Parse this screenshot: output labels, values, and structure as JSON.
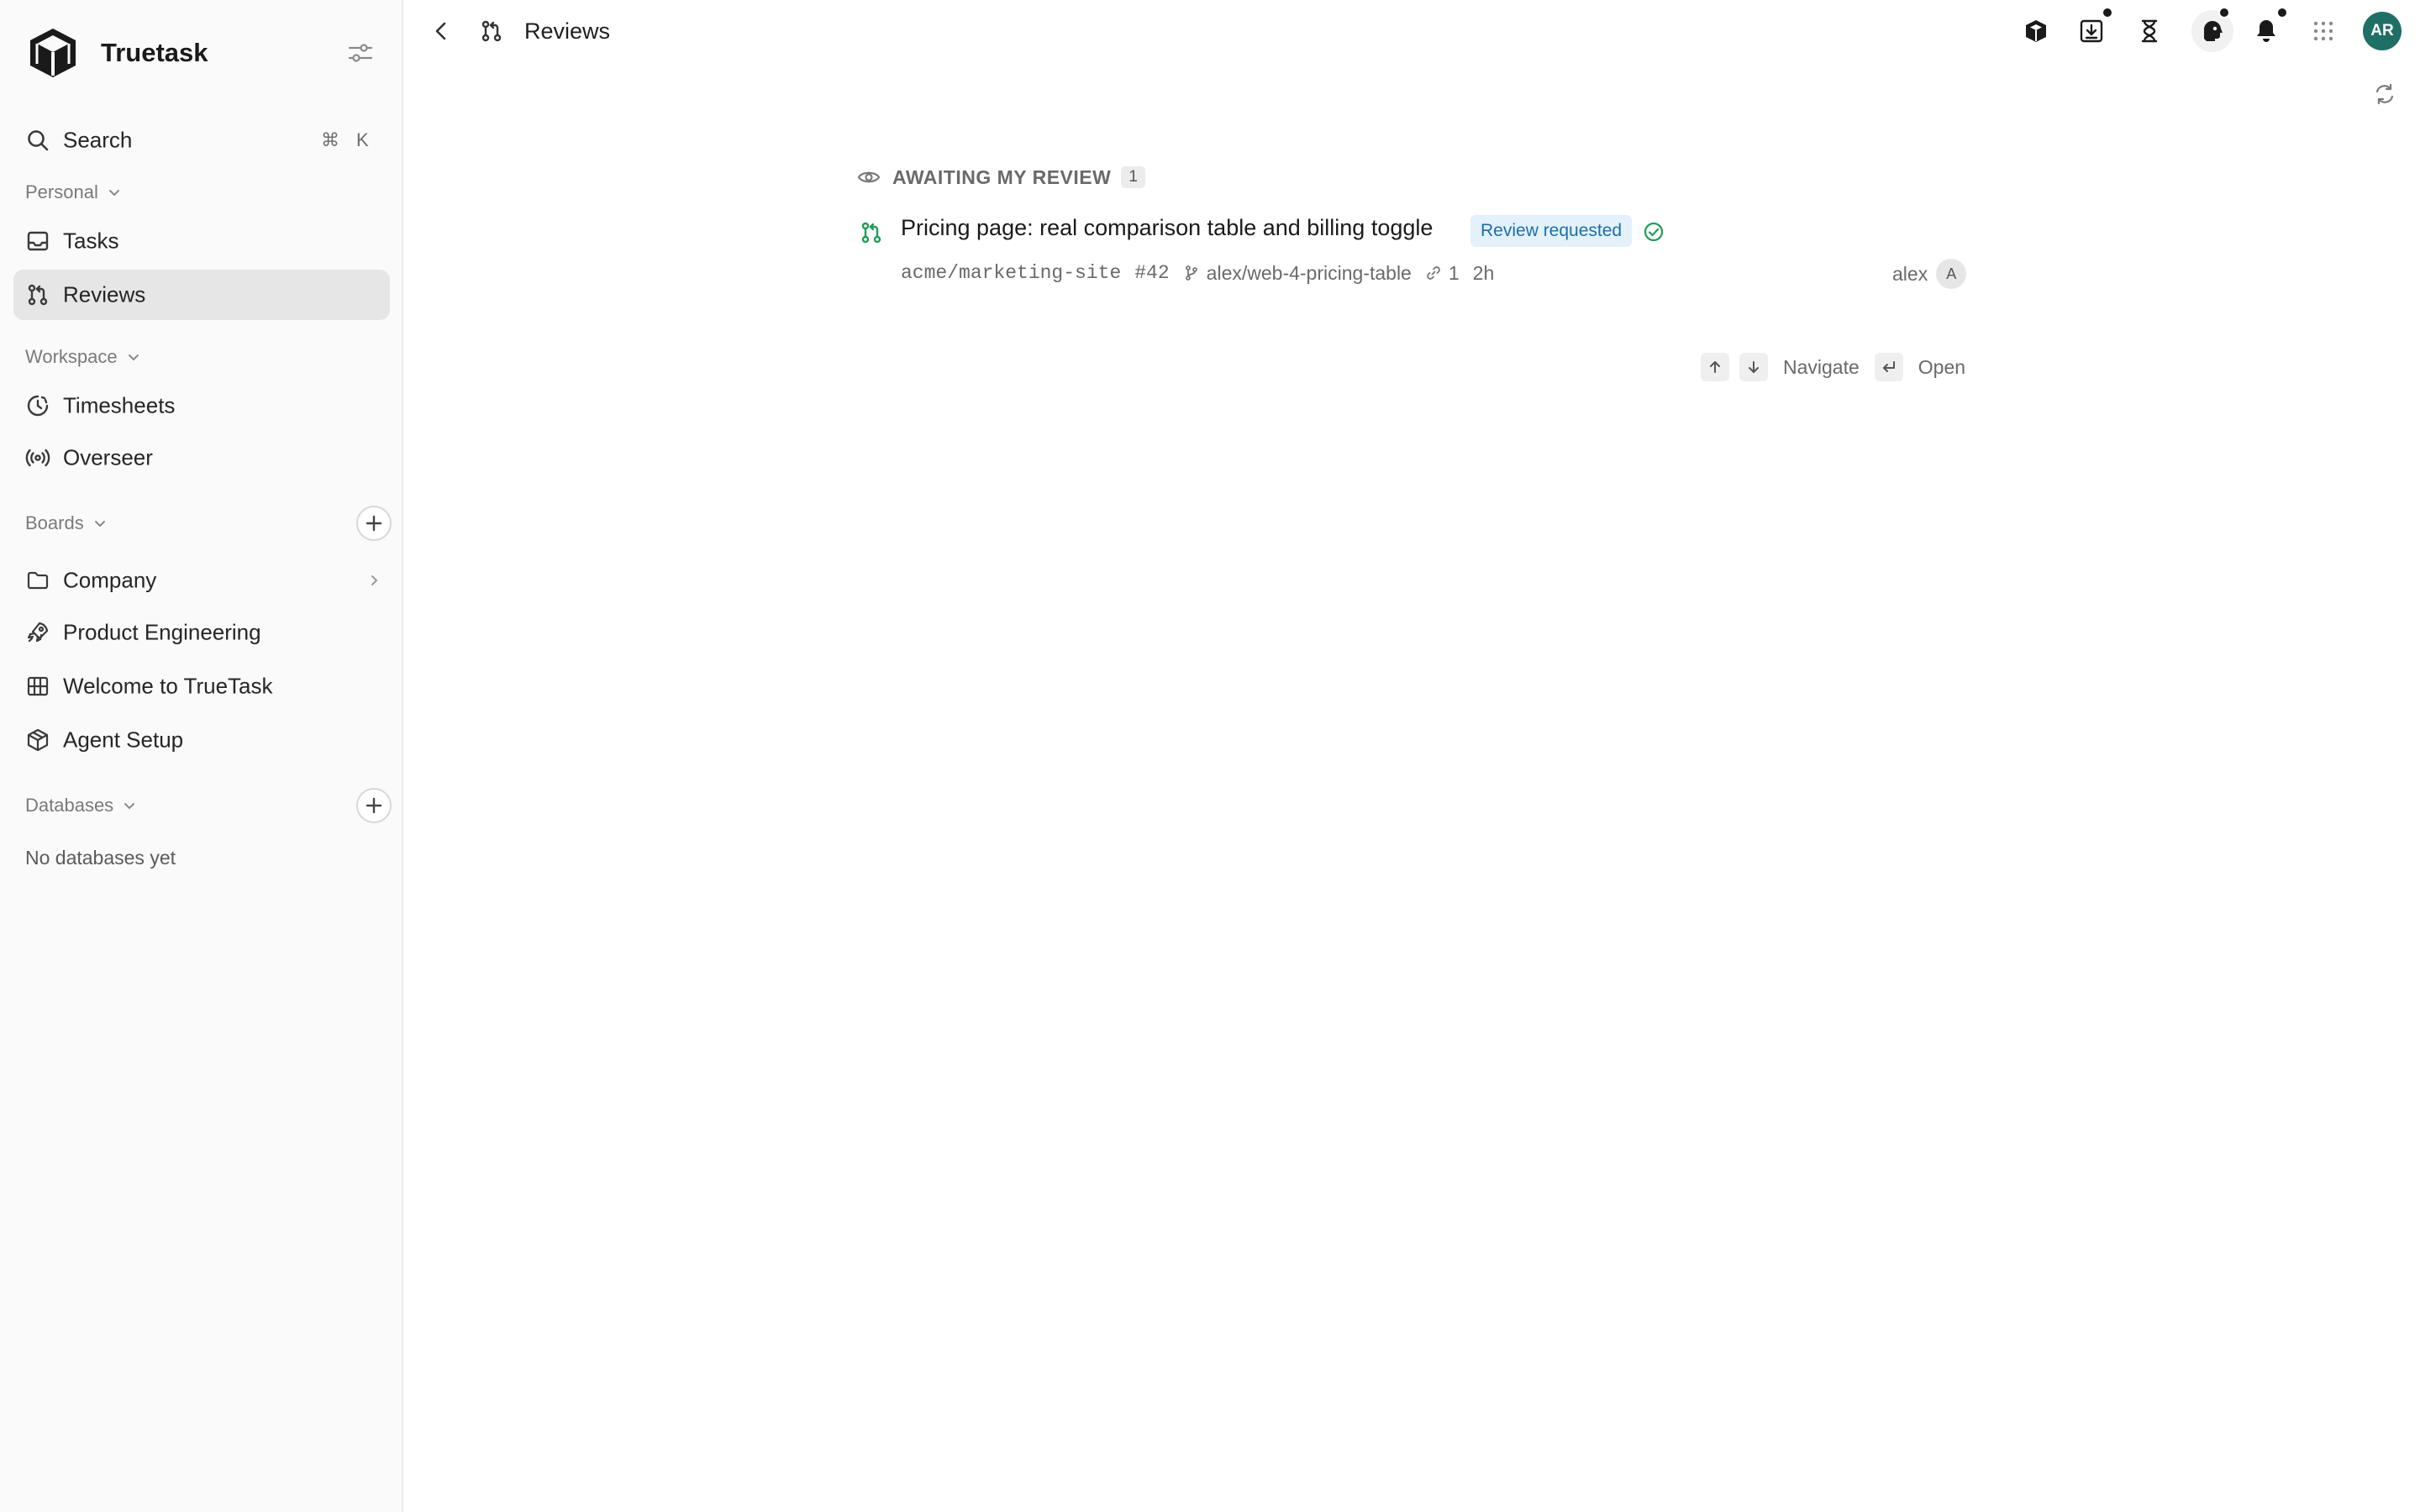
{
  "app": {
    "name": "Truetask"
  },
  "sidebar": {
    "search": {
      "label": "Search",
      "shortcut_mod": "⌘",
      "shortcut_key": "K"
    },
    "sections": {
      "personal": "Personal",
      "workspace": "Workspace",
      "boards": "Boards",
      "databases": "Databases"
    },
    "personal_items": [
      {
        "label": "Tasks",
        "icon": "inbox-icon"
      },
      {
        "label": "Reviews",
        "icon": "pull-request-icon",
        "active": true
      }
    ],
    "workspace_items": [
      {
        "label": "Timesheets",
        "icon": "clock-icon"
      },
      {
        "label": "Overseer",
        "icon": "broadcast-icon"
      }
    ],
    "board_items": [
      {
        "label": "Company",
        "icon": "folder-icon",
        "has_children": true
      },
      {
        "label": "Product Engineering",
        "icon": "rocket-icon"
      },
      {
        "label": "Welcome to TrueTask",
        "icon": "board-icon"
      },
      {
        "label": "Agent Setup",
        "icon": "cube-icon"
      }
    ],
    "databases_empty": "No databases yet"
  },
  "topbar": {
    "title": "Reviews",
    "avatar_initials": "AR"
  },
  "reviews": {
    "group_title": "AWAITING MY REVIEW",
    "group_count": "1",
    "items": [
      {
        "title": "Pricing page: real comparison table and billing toggle",
        "status": "Review requested",
        "repo": "acme/marketing-site",
        "number": "#42",
        "branch": "alex/web-4-pricing-table",
        "links": "1",
        "age": "2h",
        "author": "alex",
        "author_initial": "A"
      }
    ]
  },
  "hints": {
    "navigate": "Navigate",
    "open": "Open"
  },
  "colors": {
    "accent_green": "#1f9d55",
    "avatar_bg": "#1f6f66",
    "badge_bg": "#e3f1fb",
    "badge_text": "#1c6fa8"
  }
}
